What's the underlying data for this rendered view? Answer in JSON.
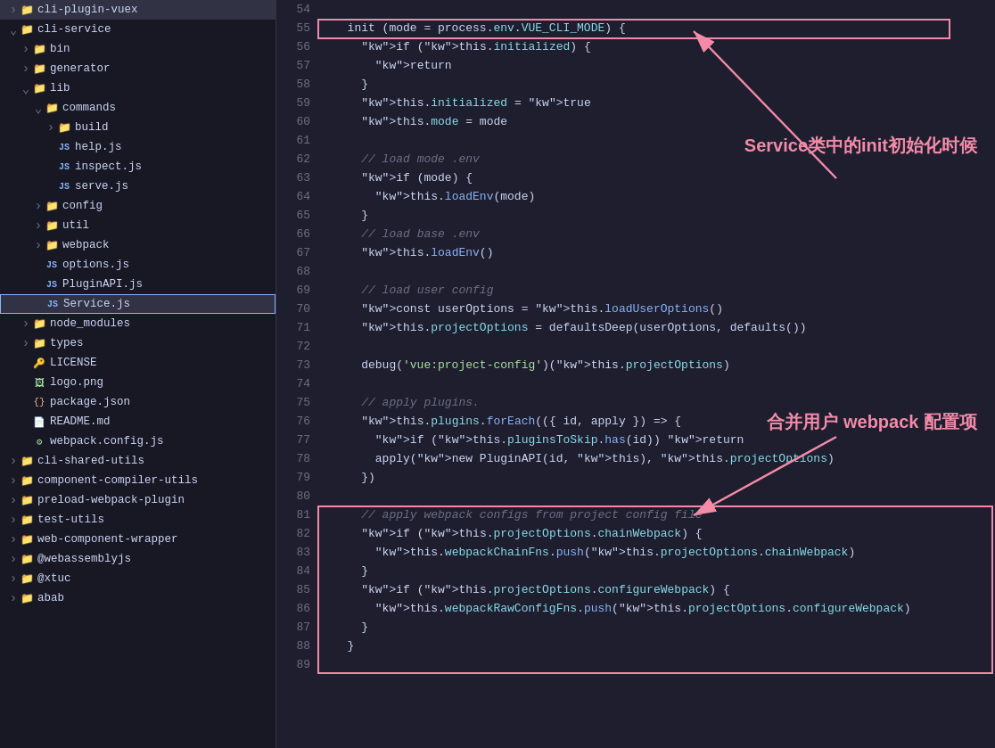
{
  "sidebar": {
    "items": [
      {
        "id": "cli-plugin-vuex",
        "label": "cli-plugin-vuex",
        "indent": "indent-1",
        "arrow": "▶",
        "type": "folder",
        "icon": "▶"
      },
      {
        "id": "cli-service",
        "label": "cli-service",
        "indent": "indent-1",
        "arrow": "▼",
        "type": "folder-open"
      },
      {
        "id": "bin",
        "label": "bin",
        "indent": "indent-2",
        "arrow": "▶",
        "type": "folder"
      },
      {
        "id": "generator",
        "label": "generator",
        "indent": "indent-2",
        "arrow": "▶",
        "type": "folder"
      },
      {
        "id": "lib",
        "label": "lib",
        "indent": "indent-2",
        "arrow": "▼",
        "type": "folder-open"
      },
      {
        "id": "commands",
        "label": "commands",
        "indent": "indent-3",
        "arrow": "▼",
        "type": "folder-open"
      },
      {
        "id": "build",
        "label": "build",
        "indent": "indent-4",
        "arrow": "▶",
        "type": "folder"
      },
      {
        "id": "help-js",
        "label": "help.js",
        "indent": "indent-4",
        "arrow": "",
        "type": "js"
      },
      {
        "id": "inspect-js",
        "label": "inspect.js",
        "indent": "indent-4",
        "arrow": "",
        "type": "js"
      },
      {
        "id": "serve-js",
        "label": "serve.js",
        "indent": "indent-4",
        "arrow": "",
        "type": "js"
      },
      {
        "id": "config",
        "label": "config",
        "indent": "indent-3",
        "arrow": "▶",
        "type": "folder"
      },
      {
        "id": "util",
        "label": "util",
        "indent": "indent-3",
        "arrow": "▶",
        "type": "folder"
      },
      {
        "id": "webpack",
        "label": "webpack",
        "indent": "indent-3",
        "arrow": "▶",
        "type": "folder"
      },
      {
        "id": "options-js",
        "label": "options.js",
        "indent": "indent-3",
        "arrow": "",
        "type": "js"
      },
      {
        "id": "PluginAPI-js",
        "label": "PluginAPI.js",
        "indent": "indent-3",
        "arrow": "",
        "type": "js"
      },
      {
        "id": "Service-js",
        "label": "Service.js",
        "indent": "indent-3",
        "arrow": "",
        "type": "js",
        "selected": true
      },
      {
        "id": "node_modules",
        "label": "node_modules",
        "indent": "indent-2",
        "arrow": "▶",
        "type": "folder"
      },
      {
        "id": "types",
        "label": "types",
        "indent": "indent-2",
        "arrow": "▶",
        "type": "folder"
      },
      {
        "id": "LICENSE",
        "label": "LICENSE",
        "indent": "indent-2",
        "arrow": "",
        "type": "lock"
      },
      {
        "id": "logo-png",
        "label": "logo.png",
        "indent": "indent-2",
        "arrow": "",
        "type": "img"
      },
      {
        "id": "package-json",
        "label": "package.json",
        "indent": "indent-2",
        "arrow": "",
        "type": "json"
      },
      {
        "id": "README-md",
        "label": "README.md",
        "indent": "indent-2",
        "arrow": "",
        "type": "md"
      },
      {
        "id": "webpack-config-js",
        "label": "webpack.config.js",
        "indent": "indent-2",
        "arrow": "",
        "type": "vue"
      },
      {
        "id": "cli-shared-utils",
        "label": "cli-shared-utils",
        "indent": "indent-1",
        "arrow": "▶",
        "type": "folder"
      },
      {
        "id": "component-compiler-utils",
        "label": "component-compiler-utils",
        "indent": "indent-1",
        "arrow": "▶",
        "type": "folder"
      },
      {
        "id": "preload-webpack-plugin",
        "label": "preload-webpack-plugin",
        "indent": "indent-1",
        "arrow": "▶",
        "type": "folder"
      },
      {
        "id": "test-utils",
        "label": "test-utils",
        "indent": "indent-1",
        "arrow": "▶",
        "type": "folder"
      },
      {
        "id": "web-component-wrapper",
        "label": "web-component-wrapper",
        "indent": "indent-1",
        "arrow": "▶",
        "type": "folder"
      },
      {
        "id": "webassemblyjs",
        "label": "@webassemblyjs",
        "indent": "indent-1",
        "arrow": "▶",
        "type": "folder"
      },
      {
        "id": "xtuc",
        "label": "@xtuc",
        "indent": "indent-1",
        "arrow": "▶",
        "type": "folder"
      },
      {
        "id": "abab",
        "label": "abab",
        "indent": "indent-1",
        "arrow": "▶",
        "type": "folder"
      }
    ]
  },
  "code": {
    "lines": [
      {
        "num": 54,
        "content": ""
      },
      {
        "num": 55,
        "content": "  init (mode = process.env.VUE_CLI_MODE) {"
      },
      {
        "num": 56,
        "content": "    if (this.initialized) {"
      },
      {
        "num": 57,
        "content": "      return"
      },
      {
        "num": 58,
        "content": "    }"
      },
      {
        "num": 59,
        "content": "    this.initialized = true"
      },
      {
        "num": 60,
        "content": "    this.mode = mode"
      },
      {
        "num": 61,
        "content": ""
      },
      {
        "num": 62,
        "content": "    // load mode .env"
      },
      {
        "num": 63,
        "content": "    if (mode) {"
      },
      {
        "num": 64,
        "content": "      this.loadEnv(mode)"
      },
      {
        "num": 65,
        "content": "    }"
      },
      {
        "num": 66,
        "content": "    // load base .env"
      },
      {
        "num": 67,
        "content": "    this.loadEnv()"
      },
      {
        "num": 68,
        "content": ""
      },
      {
        "num": 69,
        "content": "    // load user config"
      },
      {
        "num": 70,
        "content": "    const userOptions = this.loadUserOptions()"
      },
      {
        "num": 71,
        "content": "    this.projectOptions = defaultsDeep(userOptions, defaults())"
      },
      {
        "num": 72,
        "content": ""
      },
      {
        "num": 73,
        "content": "    debug('vue:project-config')(this.projectOptions)"
      },
      {
        "num": 74,
        "content": ""
      },
      {
        "num": 75,
        "content": "    // apply plugins."
      },
      {
        "num": 76,
        "content": "    this.plugins.forEach(({ id, apply }) => {"
      },
      {
        "num": 77,
        "content": "      if (this.pluginsToSkip.has(id)) return"
      },
      {
        "num": 78,
        "content": "      apply(new PluginAPI(id, this), this.projectOptions)"
      },
      {
        "num": 79,
        "content": "    })"
      },
      {
        "num": 80,
        "content": ""
      },
      {
        "num": 81,
        "content": "    // apply webpack configs from project config file"
      },
      {
        "num": 82,
        "content": "    if (this.projectOptions.chainWebpack) {"
      },
      {
        "num": 83,
        "content": "      this.webpackChainFns.push(this.projectOptions.chainWebpack)"
      },
      {
        "num": 84,
        "content": "    }"
      },
      {
        "num": 85,
        "content": "    if (this.projectOptions.configureWebpack) {"
      },
      {
        "num": 86,
        "content": "      this.webpackRawConfigFns.push(this.projectOptions.configureWebpack)"
      },
      {
        "num": 87,
        "content": "    }"
      },
      {
        "num": 88,
        "content": "  }"
      },
      {
        "num": 89,
        "content": ""
      }
    ]
  },
  "annotations": {
    "top_label": "Service类中的init初始化时候",
    "bottom_label": "合并用户 webpack 配置项"
  }
}
